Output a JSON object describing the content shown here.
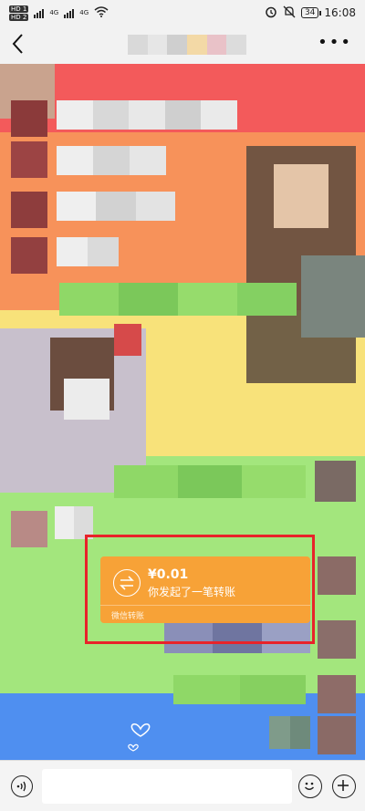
{
  "status_bar": {
    "sim1": "HD 1",
    "sim2": "HD 2",
    "net1": "4G",
    "net2": "4G",
    "battery": "34",
    "time": "16:08",
    "icons": [
      "alarm-icon",
      "mute-icon",
      "wifi-icon",
      "signal-icon",
      "battery-icon"
    ]
  },
  "nav": {
    "back_icon": "back-chevron-icon",
    "more_icon": "more-dots-icon",
    "title_obscured": true
  },
  "transfer_card": {
    "amount": "¥0.01",
    "description": "你发起了一笔转账",
    "footer": "微信转账",
    "icon": "transfer-arrows-icon",
    "color": "#f7a237"
  },
  "highlight_color": "#e8232a",
  "input_bar": {
    "voice_icon": "voice-icon",
    "emoji_icon": "emoji-icon",
    "plus_icon": "plus-icon"
  },
  "background_bands": [
    "#f35a5b",
    "#f7925a",
    "#f8e27a",
    "#a3e67d",
    "#4f8ff0"
  ]
}
